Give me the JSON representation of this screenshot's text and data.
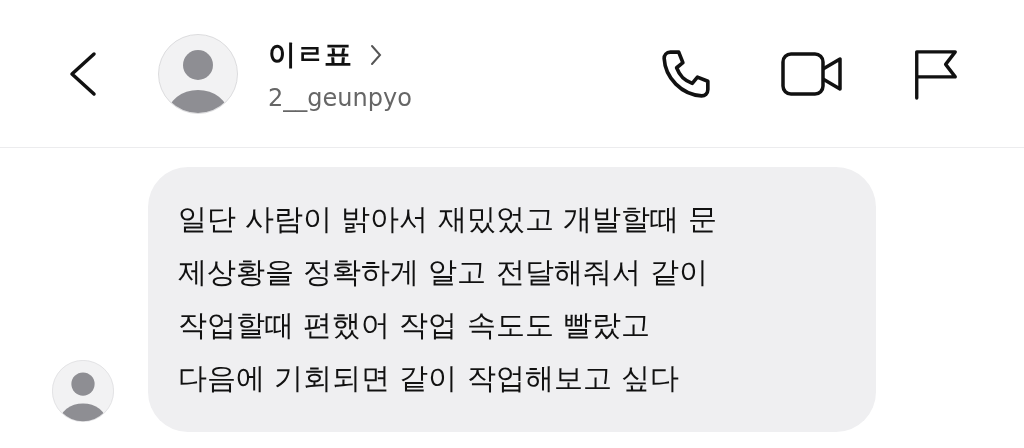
{
  "header": {
    "name": "이ㄹ표",
    "username": "2__geunpyo"
  },
  "messages": [
    {
      "lines": [
        "일단 사람이 밝아서 재밌었고 개발할때 문",
        "제상황을 정확하게 알고 전달해줘서 같이",
        "작업할때 편했어 작업 속도도 빨랐고",
        "다음에 기회되면 같이 작업해보고 싶다"
      ]
    }
  ]
}
